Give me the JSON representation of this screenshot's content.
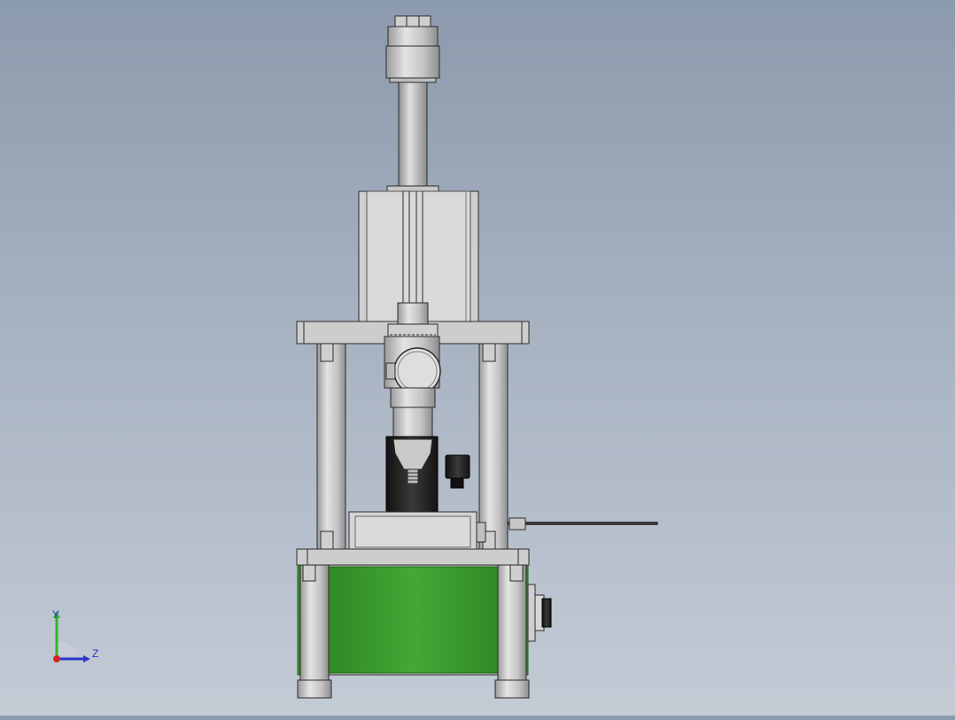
{
  "viewport": {
    "background_top": "#8c9aad",
    "background_bottom": "#c3cbd5",
    "model_colors": {
      "steel_light": "#d7d7d7",
      "steel_mid": "#b9b9b9",
      "steel_dark": "#8d8d8d",
      "edge": "#2b2b2b",
      "dark_part": "#1c1c1c",
      "green_cover": "#3b9a2f",
      "green_dark": "#1f6a16"
    }
  },
  "triad": {
    "y_label": "Y",
    "z_label": "Z",
    "y_axis_color": "#2db52d",
    "z_axis_color": "#2a33c8",
    "origin_color": "#d32222"
  }
}
